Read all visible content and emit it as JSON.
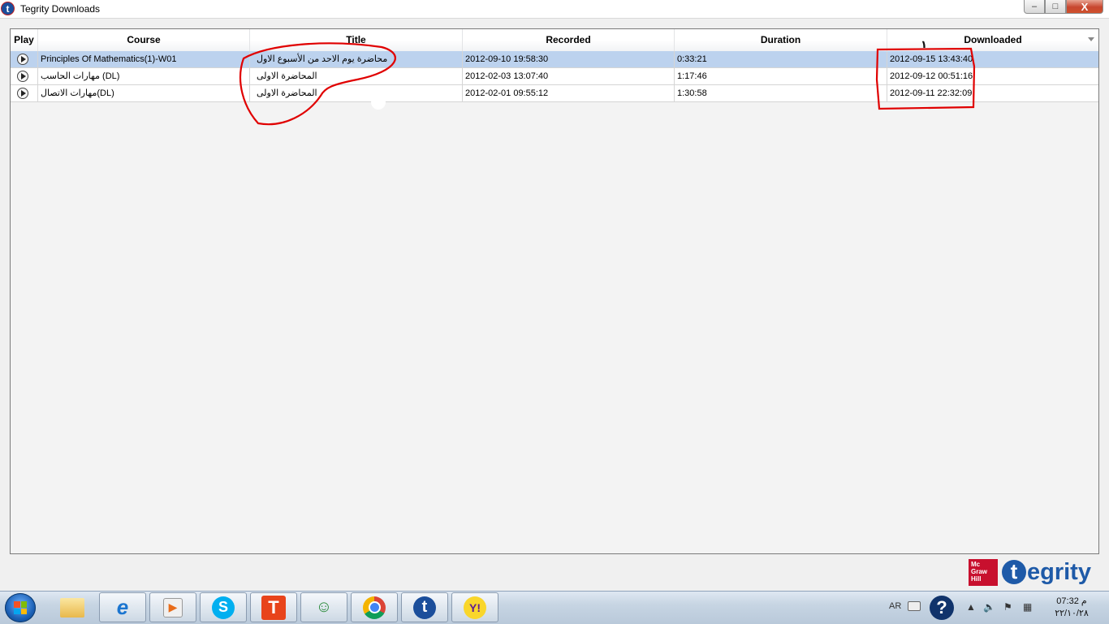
{
  "window": {
    "title": "Tegrity Downloads",
    "app_icon": "t",
    "min": "–",
    "max": "□",
    "close": "X"
  },
  "grid": {
    "columns": [
      "Play",
      "Course",
      "Title",
      "Recorded",
      "Duration",
      "Downloaded"
    ],
    "rows": [
      {
        "course": "Principles Of Mathematics(1)-W01",
        "title": "محاضرة يوم الاحد من الأسبوع الاول",
        "recorded": "2012-09-10 19:58:30",
        "duration": "0:33:21",
        "downloaded": "2012-09-15 13:43:40"
      },
      {
        "course": "مهارات الحاسب (DL)",
        "title": "المحاضرة الاولى",
        "recorded": "2012-02-03 13:07:40",
        "duration": "1:17:46",
        "downloaded": "2012-09-12 00:51:16"
      },
      {
        "course": "مهارات الاتصال(DL)",
        "title": "المحاضرة الاولى",
        "recorded": "2012-02-01 09:55:12",
        "duration": "1:30:58",
        "downloaded": "2012-09-11 22:32:09"
      }
    ],
    "selected_row": 0
  },
  "annotation": {
    "mark": "١",
    "color": "#e00000"
  },
  "branding": {
    "mcgraw": [
      "Mc",
      "Graw",
      "Hill"
    ],
    "tegrity_t": "t",
    "tegrity_rest": "egrity",
    "mcgraw_color": "#c8102e",
    "tegrity_color": "#1e5aa8"
  },
  "taskbar": {
    "apps": [
      "file-explorer",
      "internet-explorer",
      "media-player",
      "skype",
      "tegrity-t",
      "windows-live-messenger",
      "chrome",
      "tegrity",
      "yahoo-messenger"
    ],
    "tray": {
      "lang": "AR",
      "help": "?",
      "time": "07:32 م",
      "date": "٢٢/١٠/٢٨"
    }
  }
}
